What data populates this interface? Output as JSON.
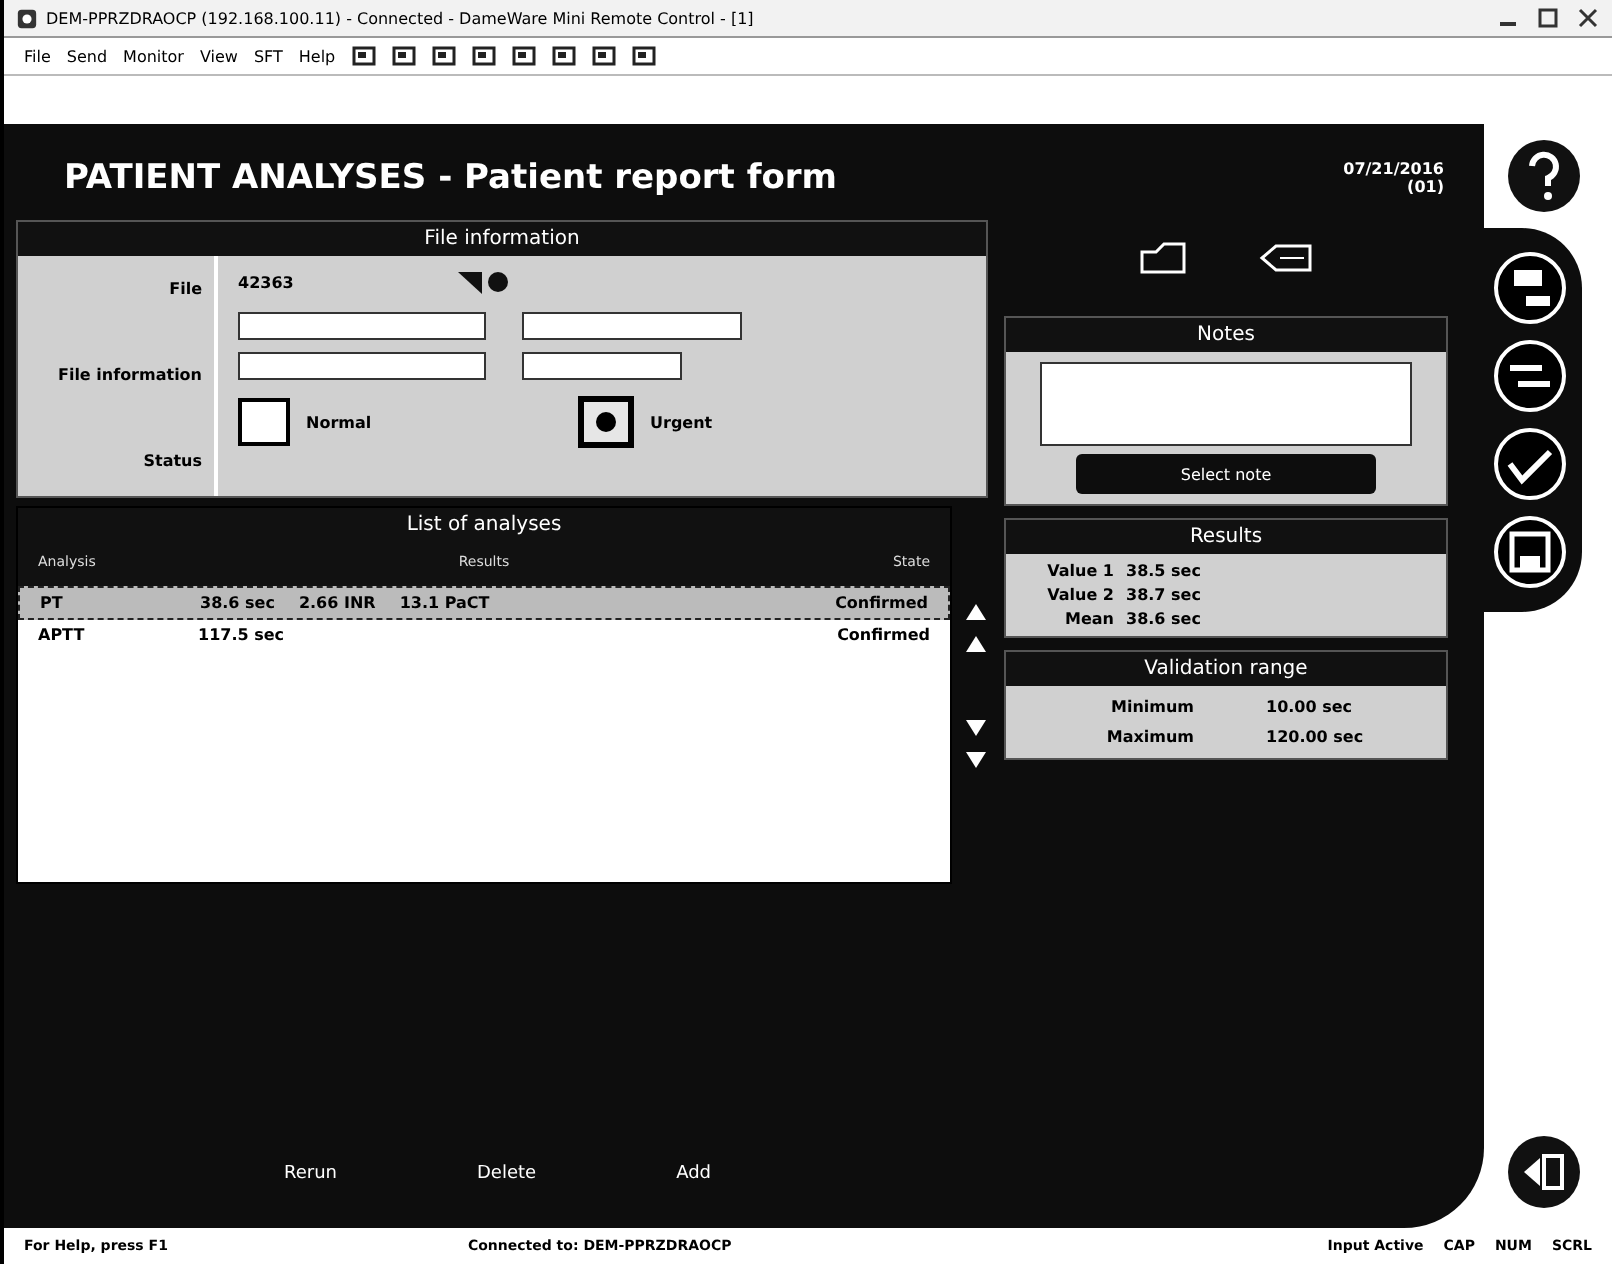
{
  "window": {
    "title": "DEM-PPRZDRAOCP (192.168.100.11) - Connected - DameWare Mini Remote Control - [1]"
  },
  "menu": [
    "File",
    "Send",
    "Monitor",
    "View",
    "SFT",
    "Help"
  ],
  "header": {
    "title": "PATIENT ANALYSES - Patient report form",
    "date": "07/21/2016",
    "code": "(01)"
  },
  "file_information": {
    "title": "File information",
    "file_label": "File",
    "file_value": "42363",
    "info_label": "File information",
    "status_label": "Status",
    "status_options": [
      {
        "label": "Normal",
        "selected": false
      },
      {
        "label": "Urgent",
        "selected": true
      }
    ]
  },
  "analyses": {
    "title": "List of analyses",
    "columns": [
      "Analysis",
      "Results",
      "State"
    ],
    "rows": [
      {
        "analysis": "PT",
        "results": [
          "38.6 sec",
          "2.66 INR",
          "13.1 PaCT"
        ],
        "state": "Confirmed",
        "selected": true
      },
      {
        "analysis": "APTT",
        "results": [
          "117.5 sec"
        ],
        "state": "Confirmed",
        "selected": false
      }
    ]
  },
  "notes": {
    "title": "Notes",
    "button": "Select note"
  },
  "results": {
    "title": "Results",
    "rows": [
      {
        "label": "Value 1",
        "value": "38.5 sec"
      },
      {
        "label": "Value 2",
        "value": "38.7 sec"
      },
      {
        "label": "Mean",
        "value": "38.6 sec"
      }
    ]
  },
  "validation_range": {
    "title": "Validation range",
    "rows": [
      {
        "label": "Minimum",
        "value": "10.00 sec"
      },
      {
        "label": "Maximum",
        "value": "120.00 sec"
      }
    ]
  },
  "buttons": [
    "Rerun",
    "Delete",
    "Add"
  ],
  "status_bar": {
    "help": "For Help, press F1",
    "connection": "Connected to: DEM-PPRZDRAOCP",
    "input": "Input Active",
    "indicators": [
      "CAP",
      "NUM",
      "SCRL"
    ]
  }
}
